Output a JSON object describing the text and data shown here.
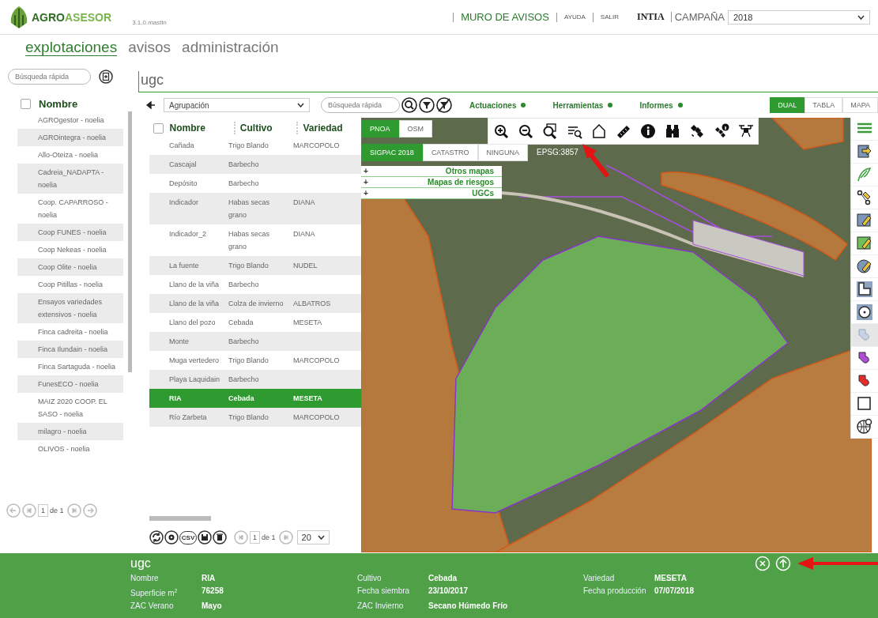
{
  "header": {
    "logo": "**AGRO**ASESOR",
    "version": "3.1.0.mastin",
    "links": [
      {
        "label": "MURO DE AVISOS",
        "kind": "primary"
      },
      {
        "label": "AYUDA",
        "kind": "small"
      },
      {
        "label": "SALIR",
        "kind": "small"
      }
    ],
    "organization": "INTIA",
    "campaign_label": "CAMPAÑA",
    "campaign_value": "2018"
  },
  "sections": [
    {
      "label": "explotaciones",
      "selected": true
    },
    {
      "label": "avisos",
      "selected": false
    },
    {
      "label": "administración",
      "selected": false
    }
  ],
  "sidebar": {
    "search": {
      "placeholder": "Búsqueda rápida"
    },
    "header": {
      "label": "Nombre",
      "checked": false
    },
    "items": [
      "AGROgestor - noelia",
      "AGROintegra - noelia",
      "Allo-Oteiza - noelia",
      "Cadreia_NADAPTA - noelia",
      "Coop. CAPARROSO - noelia",
      "Coop FUNES - noelia",
      "Coop Nekeas - noelia",
      "Coop Olite - noelia",
      "Coop Pitillas - noelia",
      "Ensayos variedades extensivos - noelia",
      "Finca cadreita - noelia",
      "Finca Ilundain - noelia",
      "Finca Sartaguda - noelia",
      "FunesECO - noelia",
      "MAIZ 2020 COOP. EL SASO - noelia",
      "milagro - noelia",
      "OLIVOS - noelia"
    ],
    "pager": {
      "page": "1",
      "of": "de 1"
    }
  },
  "main": {
    "title": "ugc",
    "grouping": "Agrupación",
    "search": {
      "placeholder": "Búsqueda rápida"
    },
    "menus": [
      {
        "label": "Actuaciones"
      },
      {
        "label": "Herramientas"
      },
      {
        "label": "Informes"
      }
    ],
    "views": [
      {
        "label": "DUAL",
        "selected": true
      },
      {
        "label": "TABLA",
        "selected": false
      },
      {
        "label": "MAPA",
        "selected": false
      }
    ]
  },
  "table": {
    "header_checked": false,
    "columns": [
      "Nombre",
      "Cultivo",
      "Variedad"
    ],
    "rows": [
      {
        "cells": [
          "Cañada",
          "Trigo Blando",
          "MARCOPOLO"
        ],
        "selected": false
      },
      {
        "cells": [
          "Cascajal",
          "Barbecho",
          ""
        ],
        "selected": false
      },
      {
        "cells": [
          "Depósito",
          "Barbecho",
          ""
        ],
        "selected": false
      },
      {
        "cells": [
          "Indicador",
          "Habas secas grano",
          "DIANA"
        ],
        "selected": false
      },
      {
        "cells": [
          "Indicador_2",
          "Habas secas grano",
          "DIANA"
        ],
        "selected": false
      },
      {
        "cells": [
          "La fuente",
          "Trigo Blando",
          "NUDEL"
        ],
        "selected": false
      },
      {
        "cells": [
          "Llano de la viña",
          "Barbecho",
          ""
        ],
        "selected": false
      },
      {
        "cells": [
          "Llano de la viña",
          "Colza de invierno",
          "ALBATROS"
        ],
        "selected": false
      },
      {
        "cells": [
          "Llano del pozo",
          "Cebada",
          "MESETA"
        ],
        "selected": false
      },
      {
        "cells": [
          "Monte",
          "Barbecho",
          ""
        ],
        "selected": false
      },
      {
        "cells": [
          "Muga vertedero",
          "Trigo Blando",
          "MARCOPOLO"
        ],
        "selected": false
      },
      {
        "cells": [
          "Playa Laquidain",
          "Barbecho",
          ""
        ],
        "selected": false
      },
      {
        "cells": [
          "RIA",
          "Cebada",
          "MESETA"
        ],
        "selected": true
      },
      {
        "cells": [
          "Río Zarbeta",
          "Trigo Blando",
          "MARCOPOLO"
        ],
        "selected": false
      }
    ],
    "toolbar": {
      "export_label": "CSV",
      "page": "1",
      "of": "de 1",
      "page_size": "20"
    }
  },
  "map": {
    "base_layers": [
      {
        "label": "PNOA",
        "selected": true
      },
      {
        "label": "OSM",
        "selected": false
      }
    ],
    "overlays": [
      {
        "label": "SIGPAC 2018",
        "selected": true
      },
      {
        "label": "CATASTRO",
        "selected": false
      },
      {
        "label": "NINGUNA",
        "selected": false
      }
    ],
    "projection": "EPSG:3857",
    "layer_groups": [
      {
        "sign": "+",
        "label": "Otros mapas"
      },
      {
        "sign": "+",
        "label": "Mapas de riesgos"
      },
      {
        "sign": "+",
        "label": "UGCs"
      }
    ],
    "side_tools": [
      {
        "disabled": false
      },
      {
        "disabled": false
      },
      {
        "disabled": false
      },
      {
        "disabled": false
      },
      {
        "disabled": false
      },
      {
        "disabled": false
      },
      {
        "disabled": false
      },
      {
        "disabled": false
      },
      {
        "disabled": false
      },
      {
        "disabled": true
      },
      {
        "disabled": false
      },
      {
        "disabled": false
      },
      {
        "disabled": false
      },
      {
        "disabled": false
      }
    ]
  },
  "detail": {
    "title": "ugc",
    "fields": [
      {
        "label": "Nombre",
        "value": "RIA"
      },
      {
        "label": "Cultivo",
        "value": "Cebada"
      },
      {
        "label": "Variedad",
        "value": "MESETA"
      },
      {
        "label": "Superficie m$^{2}$",
        "value": "76258"
      },
      {
        "label": "Fecha siembra",
        "value": "23/10/2017"
      },
      {
        "label": "Fecha producción",
        "value": "07/07/2018"
      },
      {
        "label": "ZAC Verano",
        "value": "Mayo"
      },
      {
        "label": "ZAC Invierno",
        "value": "Secano Húmedo Frío"
      }
    ]
  }
}
